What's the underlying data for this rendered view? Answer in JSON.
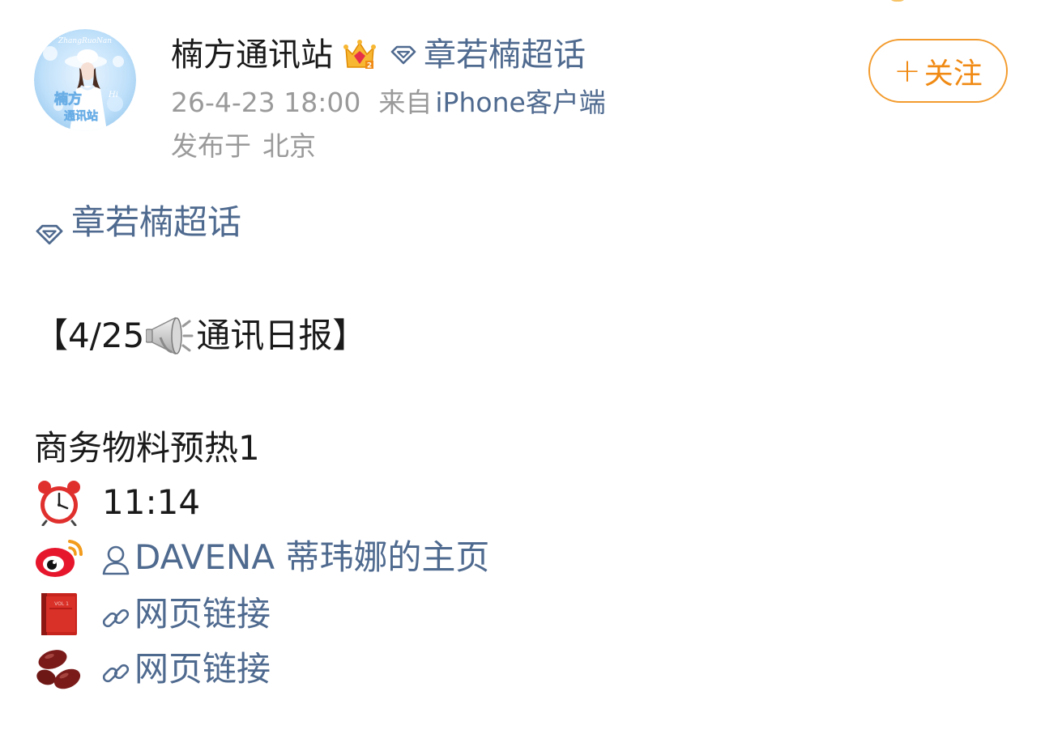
{
  "header": {
    "author_name": "楠方通讯站",
    "topic_label": "章若楠超话",
    "timestamp": "26-4-23 18:00",
    "source_prefix": "来自",
    "source_device": "iPhone客户端",
    "location_prefix": "发布于",
    "location_city": "北京",
    "avatar_text_top": "ZhangRuoNan",
    "avatar_text_main": "楠方",
    "avatar_text_sub": "通讯站",
    "avatar_text_side": "Hi",
    "follow_plus": "+",
    "follow_label": "关注"
  },
  "post": {
    "topic_label": "章若楠超话",
    "title_open_bracket": "【",
    "title_date": "4/25",
    "title_text": "通讯日报",
    "title_close_bracket": "】",
    "subtitle": "商务物料预热1",
    "time_value": "11:14",
    "weibo_user_link": "DAVENA 蒂玮娜的主页",
    "book_link": "网页链接",
    "beans_link": "网页链接",
    "book_cover_text": "VOL 1"
  },
  "icons": {
    "crown_badge": "crown-badge-icon",
    "topic": "diamond-topic-icon",
    "megaphone": "megaphone-icon",
    "clock": "alarm-clock-icon",
    "weibo": "weibo-logo-icon",
    "person": "person-icon",
    "book": "red-book-icon",
    "beans": "beans-icon",
    "link": "link-chain-icon"
  },
  "colors": {
    "link_blue": "#4f6a8f",
    "meta_gray": "#9a9a9a",
    "follow_orange": "#f08a14",
    "text_dark": "#1a1a1a"
  }
}
